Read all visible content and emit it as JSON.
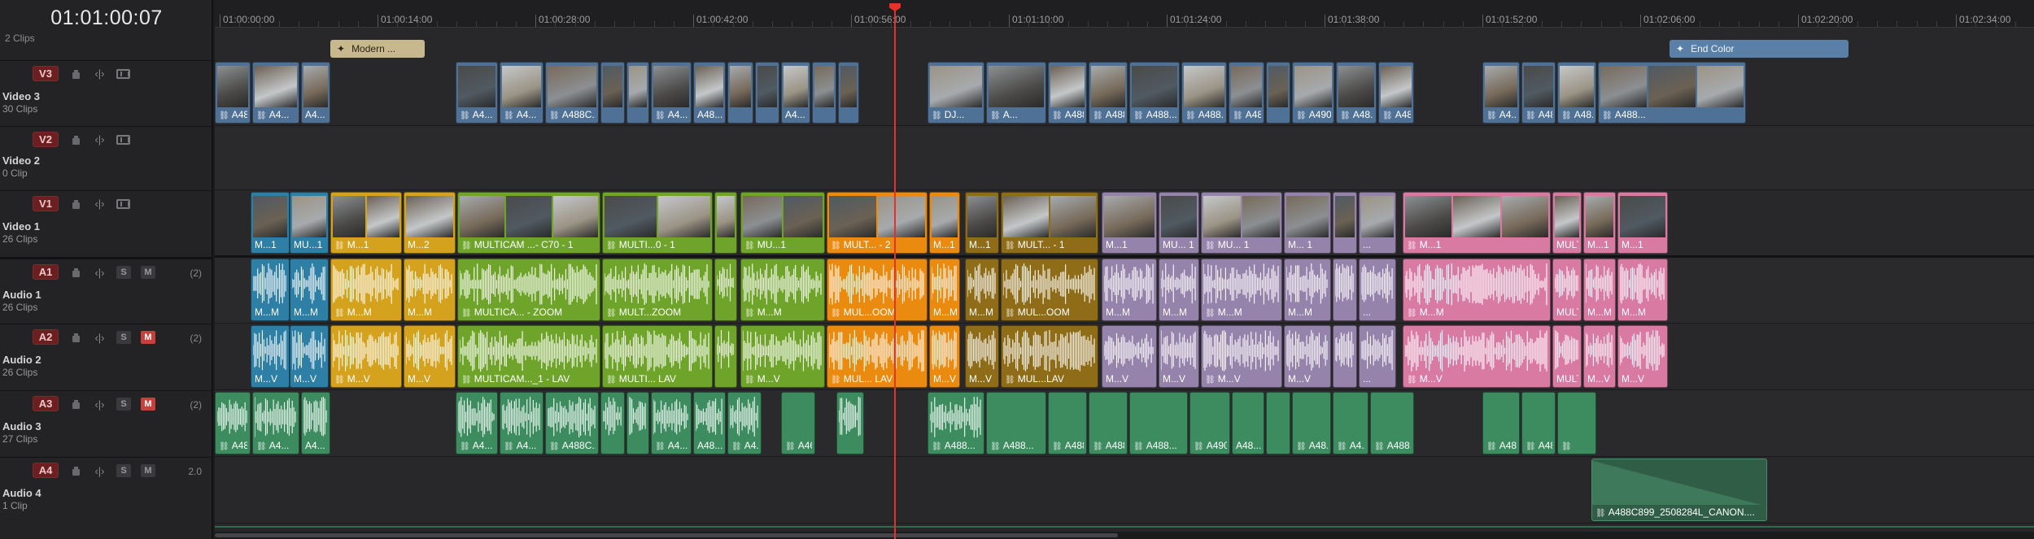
{
  "timeline": {
    "timecode": "01:01:00:07",
    "top_clip_count": "2 Clips",
    "ruler_labels": [
      "01:00:00:00",
      "01:00:14:00",
      "01:00:28:00",
      "01:00:42:00",
      "01:00:56:00",
      "01:01:10:00",
      "01:01:24:00",
      "01:01:38:00",
      "01:01:52:00",
      "01:02:06:00",
      "01:02:20:00",
      "01:02:34:00"
    ]
  },
  "tracks": [
    {
      "badge": "V3",
      "name": "Video 3",
      "clips": "30 Clips",
      "kind": "video"
    },
    {
      "badge": "V2",
      "name": "Video 2",
      "clips": "0 Clip",
      "kind": "video"
    },
    {
      "badge": "V1",
      "name": "Video 1",
      "clips": "26 Clips",
      "kind": "video"
    },
    {
      "badge": "A1",
      "name": "Audio 1",
      "clips": "26 Clips",
      "kind": "audio",
      "num": "(2)",
      "s": "S",
      "m": "M",
      "muted": false
    },
    {
      "badge": "A2",
      "name": "Audio 2",
      "clips": "26 Clips",
      "kind": "audio",
      "num": "(2)",
      "s": "S",
      "m": "M",
      "muted": true
    },
    {
      "badge": "A3",
      "name": "Audio 3",
      "clips": "27 Clips",
      "kind": "audio",
      "num": "(2)",
      "s": "S",
      "m": "M",
      "muted": true
    },
    {
      "badge": "A4",
      "name": "Audio 4",
      "clips": "1 Clip",
      "kind": "audio",
      "num": "2.0",
      "s": "S",
      "m": "M",
      "muted": false
    }
  ],
  "title_clips": [
    {
      "label": "Modern ...",
      "color": "#c8b88d"
    },
    {
      "label": "End Color",
      "color": "#5b80a8"
    }
  ],
  "labels": {
    "v3": [
      "A48...",
      "A4...",
      "A4...",
      "A4...",
      "A4...",
      "A488C...",
      "A4...",
      "A48...",
      "A4...",
      "DJ...",
      "A...",
      "A488...",
      "A488...",
      "A488...",
      "A488...",
      "A488...",
      "A490...",
      "A48...",
      "A48...",
      "A4...",
      "A488...",
      "A48...",
      "A488...",
      "A488C899_2508284L_CA..."
    ],
    "v1": [
      "M...1",
      "MU...1",
      "M...1",
      "M...2",
      "MULTICAM ...- C70 - 1",
      "MULTI...0 - 1",
      "MU...1",
      "MULT... - 2",
      "M...1",
      "M...1",
      "MULT... - 1",
      "M...1",
      "MU... 1",
      "MU... 1",
      "M... 1",
      "...",
      "M...1",
      "MULTICAM ...- C70 - 2",
      "M...1",
      "M...1",
      "..."
    ],
    "a1": [
      "M...M",
      "M...M",
      "M...M",
      "M...M",
      "MULTICA... - ZOOM",
      "MULT...ZOOM",
      "M...M",
      "MUL...OOM",
      "M...M",
      "M...M",
      "MUL...OOM",
      "M...M",
      "M...M",
      "M...M",
      "M...M",
      "...",
      "M...M",
      "MULTICA... - ZOOM",
      "M...M",
      "M...M",
      "..."
    ],
    "a2": [
      "M...V",
      "M...V",
      "M...V",
      "M...V",
      "MULTICAM..._1 - LAV",
      "MULTI... LAV",
      "M...V",
      "MUL... LAV",
      "M...V",
      "M...V",
      "MUL...LAV",
      "M...V",
      "M...V",
      "M...V",
      "M...V",
      "...",
      "M...V",
      "MULTICAM..._1 - LAV",
      "M...V",
      "M...V",
      "..."
    ],
    "a3": [
      "A48...",
      "A4...",
      "A4...",
      "A4...",
      "A4...",
      "A488C...",
      "A4...",
      "A48...",
      "A4...",
      "A46...",
      "A488...",
      "A488...",
      "A488...",
      "A488...",
      "A488...",
      "A490...",
      "A48...",
      "A48...",
      "A4...",
      "A488...",
      "A48...",
      "A488..."
    ],
    "a4": [
      "A488C899_2508284L_CANON...."
    ]
  },
  "colors": {
    "video_clip": "#4f7196",
    "audio3_clip": "#3c8c60",
    "blue": "#2e7fa6",
    "yellow": "#d4a21c",
    "green": "#6fa42a",
    "orange": "#ea8a0e",
    "brown": "#8e6c18",
    "lavender": "#9583ab",
    "pink": "#d97aa3",
    "playhead": "#e4322b"
  },
  "icons": [
    "lock-icon",
    "link-icon",
    "film-strip-icon",
    "solo-button",
    "mute-button"
  ]
}
